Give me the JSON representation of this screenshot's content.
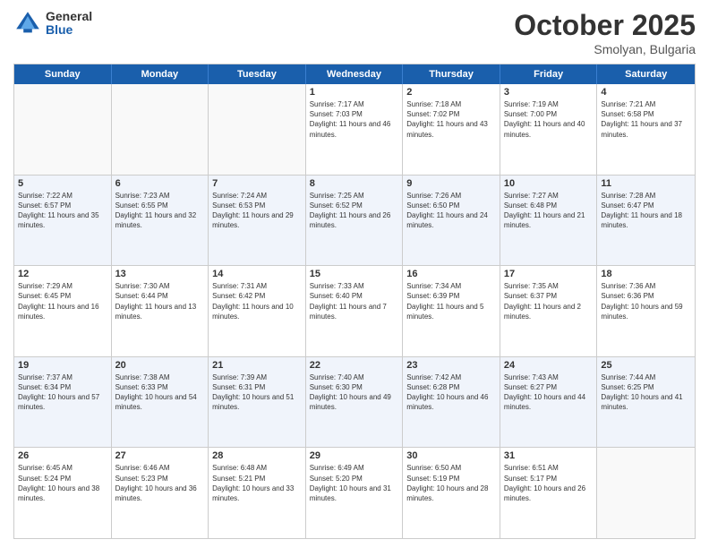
{
  "logo": {
    "general": "General",
    "blue": "Blue"
  },
  "title": "October 2025",
  "location": "Smolyan, Bulgaria",
  "header_days": [
    "Sunday",
    "Monday",
    "Tuesday",
    "Wednesday",
    "Thursday",
    "Friday",
    "Saturday"
  ],
  "rows": [
    {
      "cells": [
        {
          "day": "",
          "info": ""
        },
        {
          "day": "",
          "info": ""
        },
        {
          "day": "",
          "info": ""
        },
        {
          "day": "1",
          "info": "Sunrise: 7:17 AM\nSunset: 7:03 PM\nDaylight: 11 hours and 46 minutes."
        },
        {
          "day": "2",
          "info": "Sunrise: 7:18 AM\nSunset: 7:02 PM\nDaylight: 11 hours and 43 minutes."
        },
        {
          "day": "3",
          "info": "Sunrise: 7:19 AM\nSunset: 7:00 PM\nDaylight: 11 hours and 40 minutes."
        },
        {
          "day": "4",
          "info": "Sunrise: 7:21 AM\nSunset: 6:58 PM\nDaylight: 11 hours and 37 minutes."
        }
      ]
    },
    {
      "cells": [
        {
          "day": "5",
          "info": "Sunrise: 7:22 AM\nSunset: 6:57 PM\nDaylight: 11 hours and 35 minutes."
        },
        {
          "day": "6",
          "info": "Sunrise: 7:23 AM\nSunset: 6:55 PM\nDaylight: 11 hours and 32 minutes."
        },
        {
          "day": "7",
          "info": "Sunrise: 7:24 AM\nSunset: 6:53 PM\nDaylight: 11 hours and 29 minutes."
        },
        {
          "day": "8",
          "info": "Sunrise: 7:25 AM\nSunset: 6:52 PM\nDaylight: 11 hours and 26 minutes."
        },
        {
          "day": "9",
          "info": "Sunrise: 7:26 AM\nSunset: 6:50 PM\nDaylight: 11 hours and 24 minutes."
        },
        {
          "day": "10",
          "info": "Sunrise: 7:27 AM\nSunset: 6:48 PM\nDaylight: 11 hours and 21 minutes."
        },
        {
          "day": "11",
          "info": "Sunrise: 7:28 AM\nSunset: 6:47 PM\nDaylight: 11 hours and 18 minutes."
        }
      ]
    },
    {
      "cells": [
        {
          "day": "12",
          "info": "Sunrise: 7:29 AM\nSunset: 6:45 PM\nDaylight: 11 hours and 16 minutes."
        },
        {
          "day": "13",
          "info": "Sunrise: 7:30 AM\nSunset: 6:44 PM\nDaylight: 11 hours and 13 minutes."
        },
        {
          "day": "14",
          "info": "Sunrise: 7:31 AM\nSunset: 6:42 PM\nDaylight: 11 hours and 10 minutes."
        },
        {
          "day": "15",
          "info": "Sunrise: 7:33 AM\nSunset: 6:40 PM\nDaylight: 11 hours and 7 minutes."
        },
        {
          "day": "16",
          "info": "Sunrise: 7:34 AM\nSunset: 6:39 PM\nDaylight: 11 hours and 5 minutes."
        },
        {
          "day": "17",
          "info": "Sunrise: 7:35 AM\nSunset: 6:37 PM\nDaylight: 11 hours and 2 minutes."
        },
        {
          "day": "18",
          "info": "Sunrise: 7:36 AM\nSunset: 6:36 PM\nDaylight: 10 hours and 59 minutes."
        }
      ]
    },
    {
      "cells": [
        {
          "day": "19",
          "info": "Sunrise: 7:37 AM\nSunset: 6:34 PM\nDaylight: 10 hours and 57 minutes."
        },
        {
          "day": "20",
          "info": "Sunrise: 7:38 AM\nSunset: 6:33 PM\nDaylight: 10 hours and 54 minutes."
        },
        {
          "day": "21",
          "info": "Sunrise: 7:39 AM\nSunset: 6:31 PM\nDaylight: 10 hours and 51 minutes."
        },
        {
          "day": "22",
          "info": "Sunrise: 7:40 AM\nSunset: 6:30 PM\nDaylight: 10 hours and 49 minutes."
        },
        {
          "day": "23",
          "info": "Sunrise: 7:42 AM\nSunset: 6:28 PM\nDaylight: 10 hours and 46 minutes."
        },
        {
          "day": "24",
          "info": "Sunrise: 7:43 AM\nSunset: 6:27 PM\nDaylight: 10 hours and 44 minutes."
        },
        {
          "day": "25",
          "info": "Sunrise: 7:44 AM\nSunset: 6:25 PM\nDaylight: 10 hours and 41 minutes."
        }
      ]
    },
    {
      "cells": [
        {
          "day": "26",
          "info": "Sunrise: 6:45 AM\nSunset: 5:24 PM\nDaylight: 10 hours and 38 minutes."
        },
        {
          "day": "27",
          "info": "Sunrise: 6:46 AM\nSunset: 5:23 PM\nDaylight: 10 hours and 36 minutes."
        },
        {
          "day": "28",
          "info": "Sunrise: 6:48 AM\nSunset: 5:21 PM\nDaylight: 10 hours and 33 minutes."
        },
        {
          "day": "29",
          "info": "Sunrise: 6:49 AM\nSunset: 5:20 PM\nDaylight: 10 hours and 31 minutes."
        },
        {
          "day": "30",
          "info": "Sunrise: 6:50 AM\nSunset: 5:19 PM\nDaylight: 10 hours and 28 minutes."
        },
        {
          "day": "31",
          "info": "Sunrise: 6:51 AM\nSunset: 5:17 PM\nDaylight: 10 hours and 26 minutes."
        },
        {
          "day": "",
          "info": ""
        }
      ]
    }
  ]
}
